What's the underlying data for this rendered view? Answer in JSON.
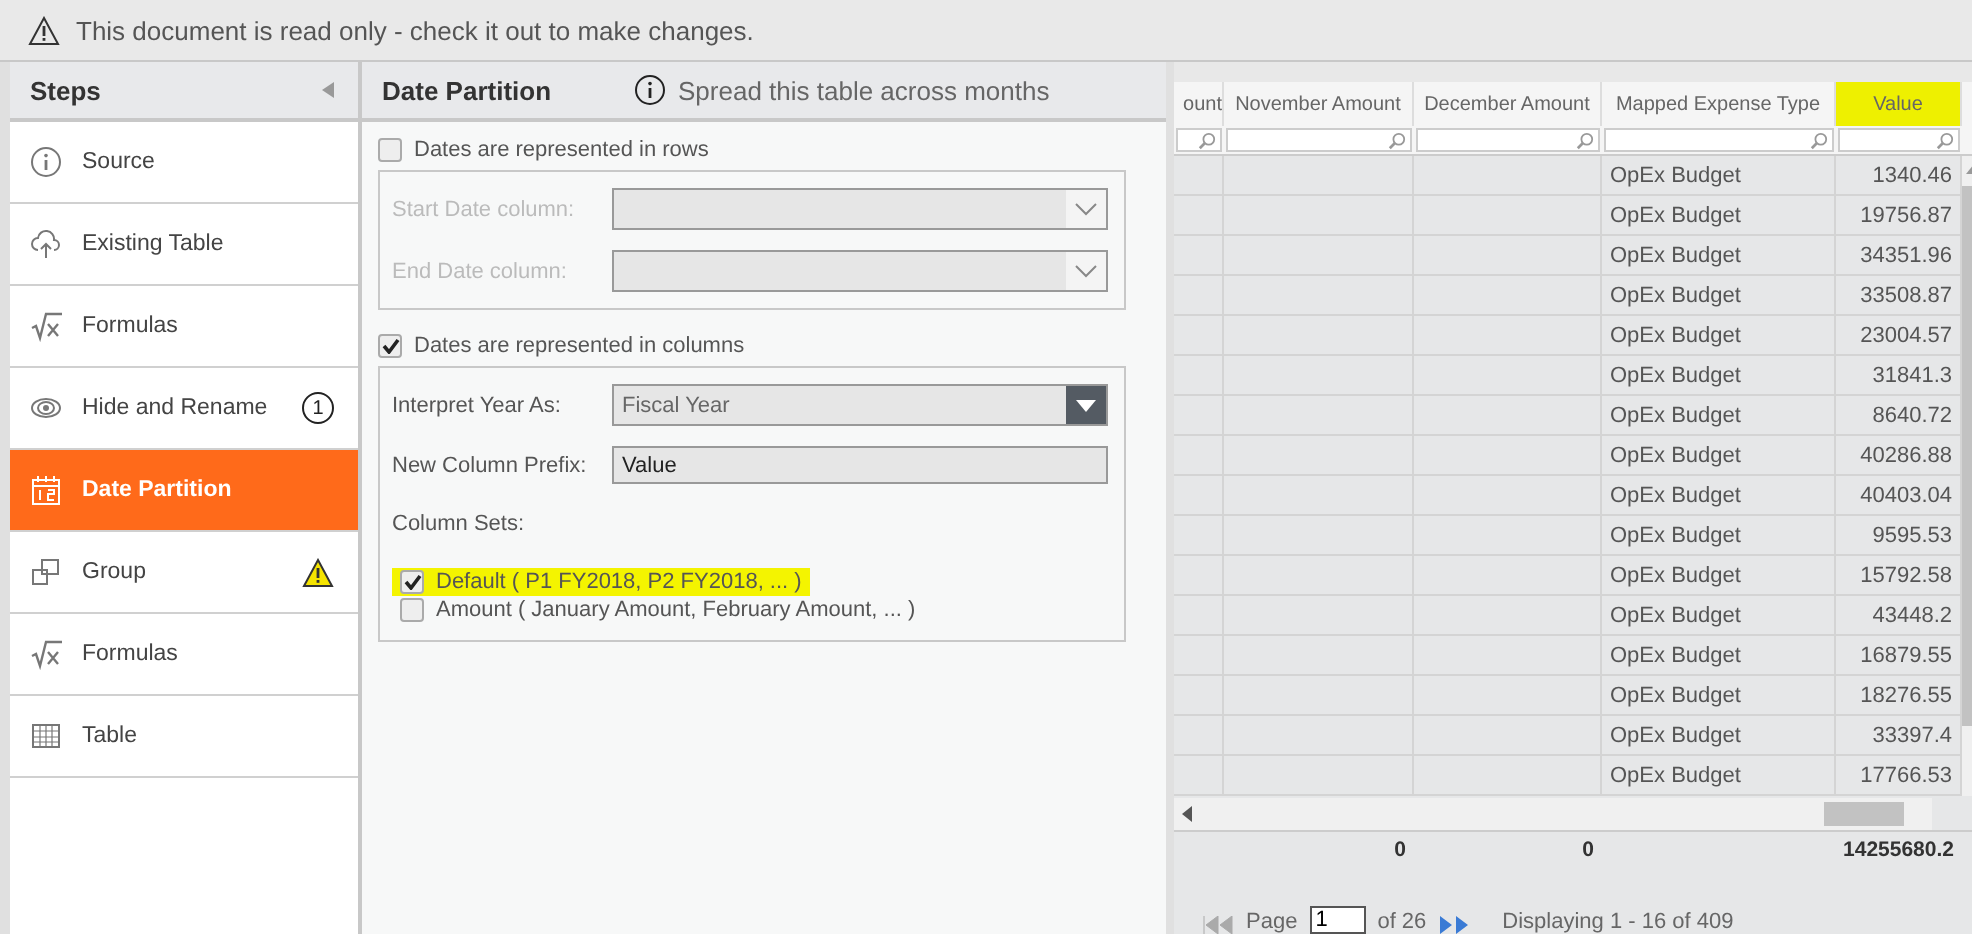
{
  "banner": {
    "text": "This document is read only - check it out to make changes."
  },
  "sidebar": {
    "title": "Steps",
    "items": [
      {
        "label": "Source",
        "kind": "info",
        "selected": false
      },
      {
        "label": "Existing Table",
        "kind": "cloud",
        "selected": false
      },
      {
        "label": "Formulas",
        "kind": "formula",
        "selected": false
      },
      {
        "label": "Hide and Rename",
        "kind": "eye",
        "selected": false,
        "badge": "1"
      },
      {
        "label": "Date Partition",
        "kind": "calendar",
        "selected": true
      },
      {
        "label": "Group",
        "kind": "group",
        "selected": false,
        "warning": true
      },
      {
        "label": "Formulas",
        "kind": "formula",
        "selected": false
      },
      {
        "label": "Table",
        "kind": "table",
        "selected": false
      }
    ]
  },
  "panel": {
    "title": "Date Partition",
    "subtitle": "Spread this table across months",
    "rows_section": {
      "label": "Dates are represented in rows",
      "checked": false,
      "fields": [
        {
          "label": "Start Date column:"
        },
        {
          "label": "End Date column:"
        }
      ]
    },
    "columns_section": {
      "label": "Dates are represented in columns",
      "checked": true,
      "year_label": "Interpret Year As:",
      "year_value": "Fiscal Year",
      "prefix_label": "New Column Prefix:",
      "prefix_value": "Value",
      "sets_label": "Column Sets:",
      "sets": [
        {
          "label": "Default ( P1 FY2018, P2 FY2018, ... )",
          "checked": true,
          "highlighted": true
        },
        {
          "label": "Amount ( January Amount, February Amount, ... )",
          "checked": false,
          "highlighted": false
        }
      ]
    }
  },
  "table": {
    "columns": [
      {
        "label": "ount",
        "highlighted": false
      },
      {
        "label": "November Amount",
        "highlighted": false
      },
      {
        "label": "December Amount",
        "highlighted": false
      },
      {
        "label": "Mapped Expense Type",
        "highlighted": false
      },
      {
        "label": "Value",
        "highlighted": true
      }
    ],
    "rows": [
      [
        "OpEx Budget",
        "1340.46"
      ],
      [
        "OpEx Budget",
        "19756.87"
      ],
      [
        "OpEx Budget",
        "34351.96"
      ],
      [
        "OpEx Budget",
        "33508.87"
      ],
      [
        "OpEx Budget",
        "23004.57"
      ],
      [
        "OpEx Budget",
        "31841.3"
      ],
      [
        "OpEx Budget",
        "8640.72"
      ],
      [
        "OpEx Budget",
        "40286.88"
      ],
      [
        "OpEx Budget",
        "40403.04"
      ],
      [
        "OpEx Budget",
        "9595.53"
      ],
      [
        "OpEx Budget",
        "15792.58"
      ],
      [
        "OpEx Budget",
        "43448.2"
      ],
      [
        "OpEx Budget",
        "16879.55"
      ],
      [
        "OpEx Budget",
        "18276.55"
      ],
      [
        "OpEx Budget",
        "33397.4"
      ],
      [
        "OpEx Budget",
        "17766.53"
      ]
    ],
    "totals": [
      "0",
      "0",
      "14255680.2"
    ],
    "pager": {
      "page_label": "Page",
      "page": "1",
      "of": "of 26",
      "display": "Displaying 1 - 16 of 409"
    }
  }
}
